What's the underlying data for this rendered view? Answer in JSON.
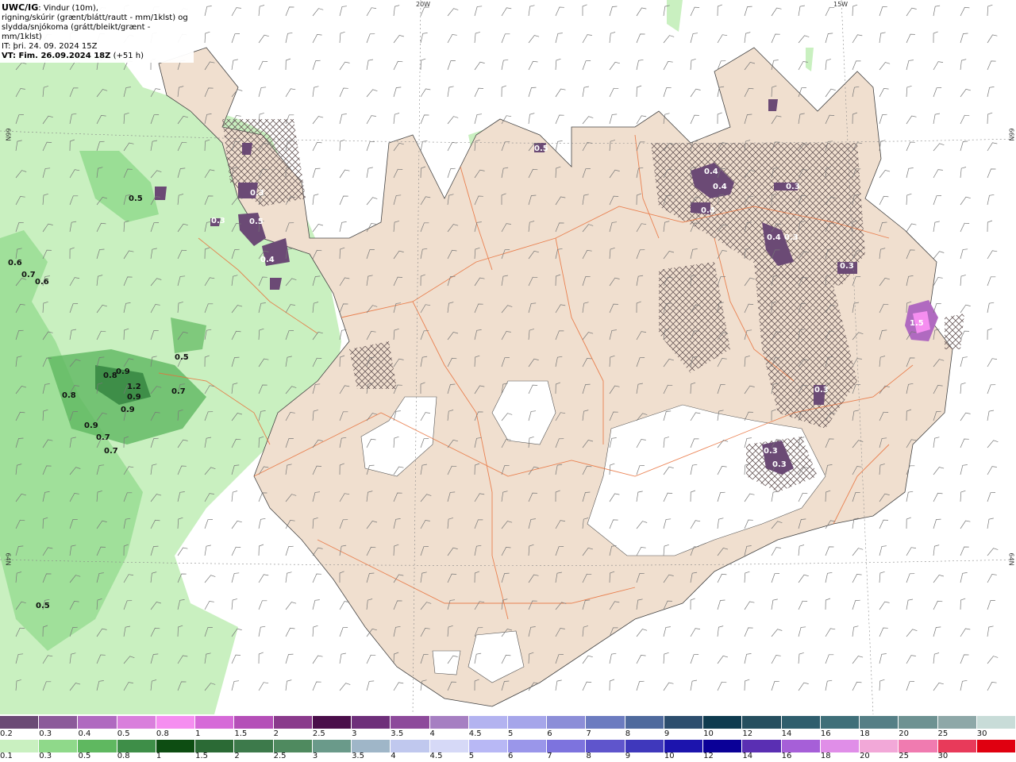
{
  "header": {
    "title": "UWC/IG",
    "title_rest": ": Vindur (10m),",
    "line2": "rigning/skúrir (grænt/blátt/rautt - mm/1klst) og",
    "line3": "slydda/snjókoma (grátt/bleikt/grænt - mm/1klst)",
    "it": "IT: þri. 24. 09. 2024 15Z",
    "vt_label": "VT: Fim. 26.09.2024 18Z",
    "vt_offset": "(+51 h)"
  },
  "grid_labels": {
    "top_left": "20W",
    "top_right": "15W",
    "left_top": "66N",
    "left_bottom": "64N",
    "right_top": "66N",
    "right_bottom": "64N"
  },
  "precip_labels": [
    {
      "text": "0.6",
      "kind": "rain"
    },
    {
      "text": "0.7",
      "kind": "rain"
    },
    {
      "text": "0.6",
      "kind": "rain"
    },
    {
      "text": "0.5",
      "kind": "rain"
    },
    {
      "text": "0.5",
      "kind": "rain"
    },
    {
      "text": "0.8",
      "kind": "rain"
    },
    {
      "text": "0.9",
      "kind": "rain"
    },
    {
      "text": "1.2",
      "kind": "rain"
    },
    {
      "text": "0.9",
      "kind": "rain"
    },
    {
      "text": "0.7",
      "kind": "rain"
    },
    {
      "text": "0.8",
      "kind": "rain"
    },
    {
      "text": "0.9",
      "kind": "rain"
    },
    {
      "text": "0.9",
      "kind": "rain"
    },
    {
      "text": "0.7",
      "kind": "rain"
    },
    {
      "text": "0.7",
      "kind": "rain"
    },
    {
      "text": "0.5",
      "kind": "rain"
    },
    {
      "text": "0.4",
      "kind": "snow"
    },
    {
      "text": "0.4",
      "kind": "snow"
    },
    {
      "text": "0.3",
      "kind": "snow"
    },
    {
      "text": "0.4",
      "kind": "snow"
    },
    {
      "text": "0.3",
      "kind": "snow"
    },
    {
      "text": "0.4",
      "kind": "snow"
    },
    {
      "text": "0.3",
      "kind": "snow"
    },
    {
      "text": "0.3",
      "kind": "snow"
    },
    {
      "text": "1.5",
      "kind": "snow"
    },
    {
      "text": "0.3",
      "kind": "snow"
    },
    {
      "text": "0.3",
      "kind": "snow"
    },
    {
      "text": "0.3",
      "kind": "snow"
    },
    {
      "text": "0.5",
      "kind": "snow"
    },
    {
      "text": "0.4",
      "kind": "snow"
    },
    {
      "text": "0.5",
      "kind": "snow"
    },
    {
      "text": "0.3",
      "kind": "snow"
    }
  ],
  "legend": {
    "snow_ticks": [
      "0.2",
      "0.3",
      "0.4",
      "0.5",
      "0.8",
      "1",
      "1.5",
      "2",
      "2.5",
      "3",
      "3.5",
      "4",
      "4.5",
      "5",
      "6",
      "7",
      "8",
      "9",
      "10",
      "12",
      "14",
      "16",
      "18",
      "20",
      "25",
      "30"
    ],
    "snow_colors": [
      "#6b4a75",
      "#8c5a9a",
      "#b06ac0",
      "#d97fdc",
      "#f58ef0",
      "#d66ad8",
      "#b54fb8",
      "#8a3a8c",
      "#4a0e4a",
      "#6e2f7a",
      "#8d4a9b",
      "#a67fc2",
      "#b3b3f0",
      "#a6a6ea",
      "#8c8ed8",
      "#6c7cc0",
      "#4f6a9d",
      "#2d4e6e",
      "#0f3b4f",
      "#264f5f",
      "#2f5e6d",
      "#3f6f79",
      "#557f86",
      "#6e9292",
      "#8ea8a8",
      "#c8dcd8"
    ],
    "rain_ticks": [
      "0.1",
      "0.3",
      "0.5",
      "0.8",
      "1",
      "1.5",
      "2",
      "2.5",
      "3",
      "3.5",
      "4",
      "4.5",
      "5",
      "6",
      "7",
      "8",
      "9",
      "10",
      "12",
      "14",
      "16",
      "18",
      "20",
      "25",
      "30"
    ],
    "rain_colors": [
      "#c9f0c0",
      "#8fd98a",
      "#5fb860",
      "#3e8e48",
      "#0d4d12",
      "#2b6a35",
      "#3d7a4b",
      "#4f8a5f",
      "#6a9a8a",
      "#9fb6c8",
      "#c0c8ee",
      "#d6d9f7",
      "#b8b8f5",
      "#9a96ea",
      "#7d73de",
      "#5f55cc",
      "#3f38bc",
      "#1c14ad",
      "#0a0097",
      "#5a2fb3",
      "#a65fd8",
      "#e08ee8",
      "#f2a8d8",
      "#f07bb0",
      "#e83a5a",
      "#e00010"
    ]
  }
}
